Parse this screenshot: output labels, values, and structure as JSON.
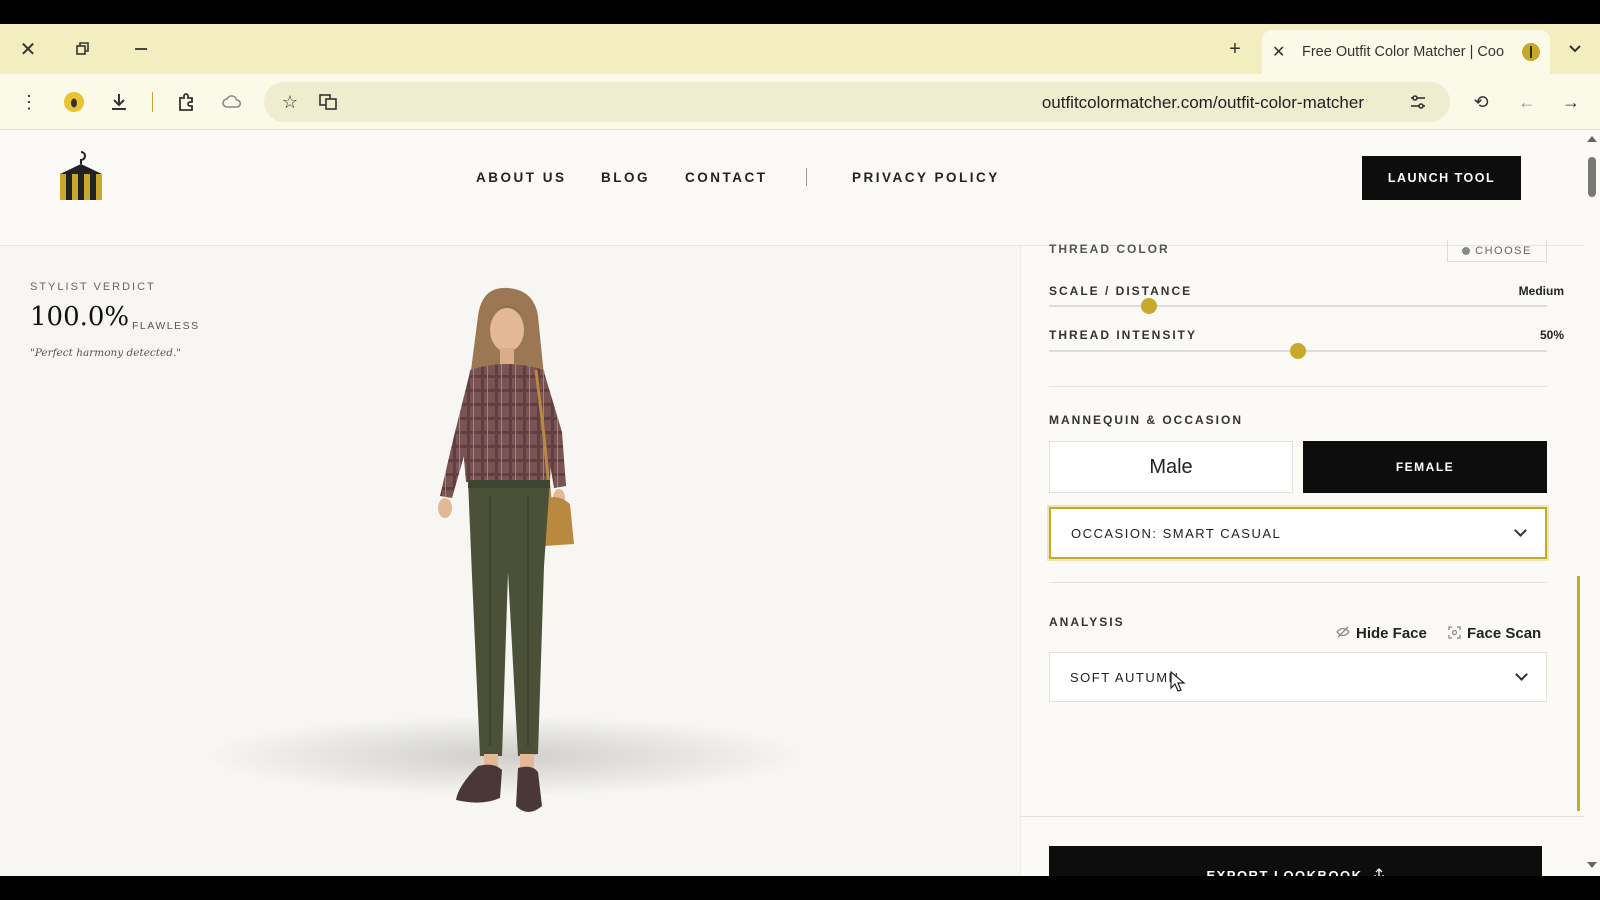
{
  "browser": {
    "tab_title": "Free Outfit Color Matcher | Coo",
    "url": "outfitcolormatcher.com/outfit-color-matcher"
  },
  "site": {
    "nav": [
      "ABOUT US",
      "BLOG",
      "CONTACT",
      "PRIVACY POLICY"
    ],
    "launch_label": "LAUNCH TOOL"
  },
  "verdict": {
    "label": "STYLIST VERDICT",
    "score": "100.0%",
    "tag": "FLAWLESS",
    "quote": "\"Perfect harmony detected.\""
  },
  "panel": {
    "thread_color_label": "THREAD COLOR",
    "choose_label": "CHOOSE",
    "scale_label": "SCALE / DISTANCE",
    "scale_value": "Medium",
    "scale_level": 0.2,
    "intensity_label": "THREAD INTENSITY",
    "intensity_value": "50%",
    "intensity_level": 0.5,
    "mannequin_label": "MANNEQUIN & OCCASION",
    "male_label": "Male",
    "female_label": "FEMALE",
    "selected_mannequin": "FEMALE",
    "occasion_value": "OCCASION: SMART CASUAL",
    "analysis_label": "ANALYSIS",
    "hide_face_label": "Hide Face",
    "face_scan_label": "Face Scan",
    "season_value": "SOFT AUTUMN",
    "export_label": "EXPORT LOOKBOOK"
  },
  "colors": {
    "accent_gold": "#c9a82c",
    "tabstrip": "#f3eec0",
    "dark": "#0d0d0d",
    "top_plaid": "#7a5454",
    "trousers": "#4a5138"
  }
}
